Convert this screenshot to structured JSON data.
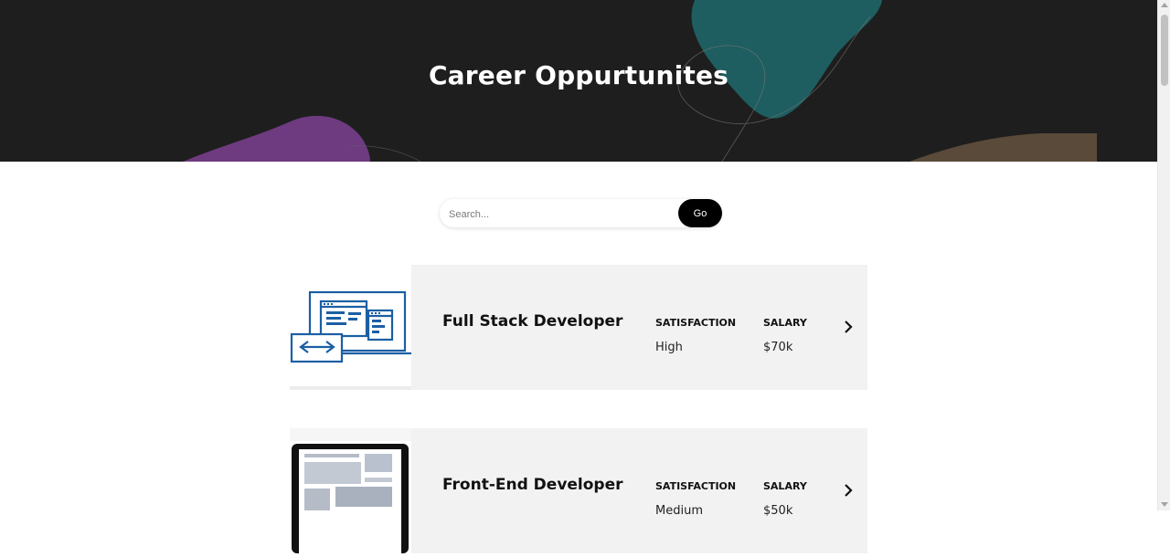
{
  "hero": {
    "title": "Career Oppurtunites",
    "colors": {
      "background": "#1e1e1e",
      "teal": "#1e5e60",
      "purple": "#6e3a80",
      "brown": "#5a4a3a"
    }
  },
  "search": {
    "placeholder": "Search...",
    "value": "",
    "button_label": "Go"
  },
  "careers": [
    {
      "title": "Full Stack Developer",
      "satisfaction_label": "SATISFACTION",
      "satisfaction": "High",
      "salary_label": "SALARY",
      "salary": "$70k",
      "icon": "code-window-laptop-icon"
    },
    {
      "title": "Front-End Developer",
      "satisfaction_label": "SATISFACTION",
      "satisfaction": "Medium",
      "salary_label": "SALARY",
      "salary": "$50k",
      "icon": "monitor-layout-icon"
    }
  ]
}
